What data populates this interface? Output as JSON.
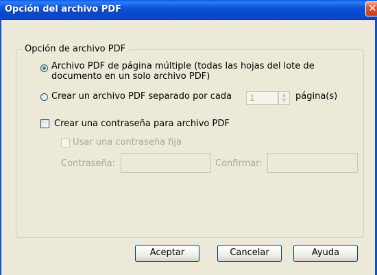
{
  "window": {
    "title": "Opción del archivo PDF",
    "close_glyph": "✕"
  },
  "group": {
    "label": "Opción de archivo PDF"
  },
  "options": {
    "multipage_label": "Archivo PDF de página múltiple (todas las hojas del lote de documento en un solo archivo PDF)",
    "separate_label": "Crear un archivo PDF separado por cada",
    "pages_value": "1",
    "pages_suffix": "página(s)",
    "selected": "multipage"
  },
  "password": {
    "create_label": "Crear una contraseña para archivo PDF",
    "create_checked": false,
    "fixed_label": "Usar una contraseña fija",
    "fixed_checked": false,
    "password_label": "Contraseña:",
    "password_value": "",
    "confirm_label": "Confirmar:",
    "confirm_value": ""
  },
  "buttons": {
    "ok": "Aceptar",
    "cancel": "Cancelar",
    "help": "Ayuda"
  },
  "colors": {
    "titlebar": "#0a4ac7",
    "dialog_bg": "#ece9d8",
    "close_button": "#e35630",
    "radio_dot": "#21a121",
    "disabled_text": "#aca899"
  },
  "icons": {
    "close": "close-icon",
    "spin_up": "spin-up-icon",
    "spin_down": "spin-down-icon"
  }
}
